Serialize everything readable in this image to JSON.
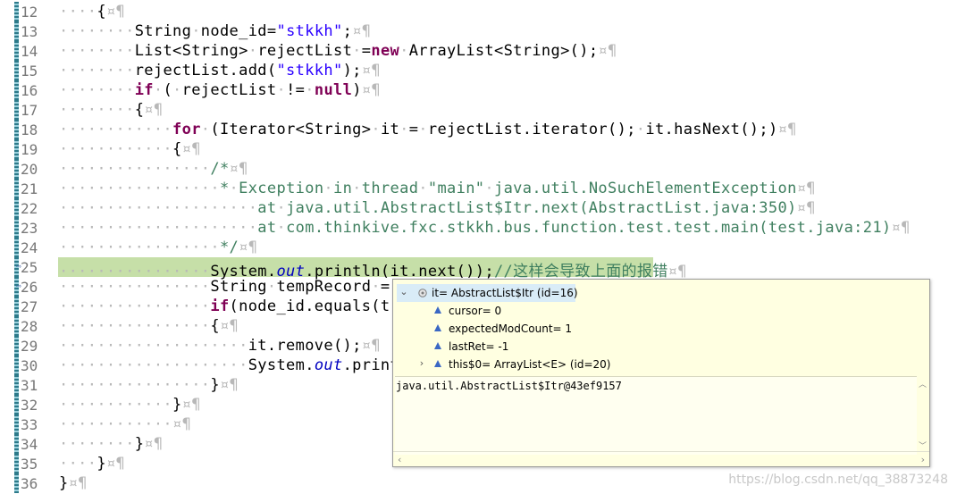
{
  "editor": {
    "lines": [
      {
        "n": "12",
        "ws": "····",
        "html": "{<span class=\"ws\">¤¶</span>"
      },
      {
        "n": "13",
        "ws": "········",
        "html": "String<span class=\"ws\">·</span>node_id=<span class=\"str\">\"stkkh\"</span>;<span class=\"ws\">¤¶</span>"
      },
      {
        "n": "14",
        "ws": "········",
        "html": "List&lt;String&gt;<span class=\"ws\">·</span>rejectList<span class=\"ws\">·</span>=<span class=\"kw\">new</span><span class=\"ws\">·</span>ArrayList&lt;String&gt;();<span class=\"ws\">¤¶</span>"
      },
      {
        "n": "15",
        "ws": "········",
        "html": "rejectList.add(<span class=\"str\">\"stkkh\"</span>);<span class=\"ws\">¤¶</span>"
      },
      {
        "n": "16",
        "ws": "········",
        "html": "<span class=\"kw\">if</span><span class=\"ws\">·</span>(<span class=\"ws\">·</span>rejectList<span class=\"ws\">·</span>!=<span class=\"ws\">·</span><span class=\"kw\">null</span>)<span class=\"ws\">¤¶</span>"
      },
      {
        "n": "17",
        "ws": "········",
        "html": "{<span class=\"ws\">¤¶</span>"
      },
      {
        "n": "18",
        "ws": "············",
        "html": "<span class=\"kw\">for</span><span class=\"ws\">·</span>(Iterator&lt;String&gt;<span class=\"ws\">·</span>it<span class=\"ws\">·</span>=<span class=\"ws\">·</span>rejectList.iterator();<span class=\"ws\">·</span>it.hasNext();)<span class=\"ws\">¤¶</span>"
      },
      {
        "n": "19",
        "ws": "············",
        "html": "{<span class=\"ws\">¤¶</span>"
      },
      {
        "n": "20",
        "ws": "················",
        "html": "<span class=\"cm\">/*</span><span class=\"ws\">¤¶</span>"
      },
      {
        "n": "21",
        "ws": "················",
        "html": "<span class=\"cm\"><span class=\"ws\">·</span>*<span class=\"ws\">·</span>Exception<span class=\"ws\">·</span>in<span class=\"ws\">·</span>thread<span class=\"ws\">·</span>\"main\"<span class=\"ws\">·</span>java.util.NoSuchElementException</span><span class=\"ws\">¤¶</span>"
      },
      {
        "n": "22",
        "ws": "················",
        "html": "<span class=\"cm\"><span class=\"ws\">·····</span>at<span class=\"ws\">·</span>java.util.AbstractList$Itr.next(AbstractList.java:350)</span><span class=\"ws\">¤¶</span>"
      },
      {
        "n": "23",
        "ws": "················",
        "html": "<span class=\"cm\"><span class=\"ws\">·····</span>at<span class=\"ws\">·</span>com.thinkive.fxc.stkkh.bus.function.test.test.main(test.java:21)</span><span class=\"ws\">¤¶</span>"
      },
      {
        "n": "24",
        "ws": "················",
        "html": "<span class=\"cm\"><span class=\"ws\">·</span>*/</span><span class=\"ws\">¤¶</span>"
      },
      {
        "n": "25",
        "ws": "················",
        "html": "System.<span class=\"ital\">out</span>.println(it.next());<span class=\"cm\">//这样会导致上面的报错</span><span class=\"ws\">¤¶</span>",
        "highlight": true
      },
      {
        "n": "26",
        "ws": "················",
        "html": "String<span class=\"ws\">·</span>tempRecord<span class=\"ws\">·</span>="
      },
      {
        "n": "27",
        "ws": "················",
        "html": "<span class=\"kw\">if</span>(node_id.equals(t"
      },
      {
        "n": "28",
        "ws": "················",
        "html": "{<span class=\"ws\">¤¶</span>"
      },
      {
        "n": "29",
        "ws": "····················",
        "html": "it.remove();<span class=\"ws\">¤¶</span>"
      },
      {
        "n": "30",
        "ws": "····················",
        "html": "System.<span class=\"ital\">out</span>.print"
      },
      {
        "n": "31",
        "ws": "················",
        "html": "}<span class=\"ws\">¤¶</span>"
      },
      {
        "n": "32",
        "ws": "············",
        "html": "}<span class=\"ws\">¤¶</span>"
      },
      {
        "n": "33",
        "ws": "············",
        "html": "<span class=\"ws\">¤¶</span>"
      },
      {
        "n": "34",
        "ws": "········",
        "html": "}<span class=\"ws\">¤¶</span>"
      },
      {
        "n": "35",
        "ws": "····",
        "html": "}<span class=\"ws\">¤¶</span>"
      },
      {
        "n": "36",
        "ws": "",
        "html": "}<span class=\"ws\">¤¶</span>"
      }
    ]
  },
  "popup": {
    "root_label": "it= AbstractList$Itr  (id=16)",
    "children": [
      {
        "label": "cursor= 0",
        "expandable": false
      },
      {
        "label": "expectedModCount= 1",
        "expandable": false
      },
      {
        "label": "lastRet= -1",
        "expandable": false
      },
      {
        "label": "this$0= ArrayList<E>  (id=20)",
        "expandable": true
      }
    ],
    "detail": "java.util.AbstractList$Itr@43ef9157"
  },
  "watermark": "https://blog.csdn.net/qq_38873248",
  "colors": {
    "line_highlight": "#c6dfa8",
    "keyword": "#7f0055",
    "string": "#2a00ff",
    "comment": "#3f7f5f",
    "popup_bg": "#ffffe1"
  }
}
